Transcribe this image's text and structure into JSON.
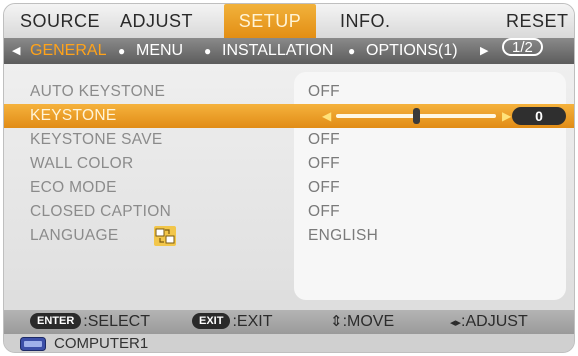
{
  "tabs": [
    {
      "label": "SOURCE",
      "active": false
    },
    {
      "label": "ADJUST",
      "active": false
    },
    {
      "label": "SETUP",
      "active": true
    },
    {
      "label": "INFO.",
      "active": false
    },
    {
      "label": "RESET",
      "active": false
    }
  ],
  "subtabs": {
    "prev_arrow": "◀",
    "items": [
      "GENERAL",
      "MENU",
      "INSTALLATION",
      "OPTIONS(1)"
    ],
    "selected": "GENERAL",
    "next_arrow": "▶",
    "page": "1/2"
  },
  "settings": [
    {
      "label": "AUTO KEYSTONE",
      "value": "OFF"
    },
    {
      "label": "KEYSTONE",
      "value": "0",
      "selected": true,
      "slider_level": 0.5
    },
    {
      "label": "KEYSTONE SAVE",
      "value": "OFF"
    },
    {
      "label": "WALL COLOR",
      "value": "OFF"
    },
    {
      "label": "ECO MODE",
      "value": "OFF"
    },
    {
      "label": "CLOSED CAPTION",
      "value": "OFF"
    },
    {
      "label": "LANGUAGE",
      "value": "ENGLISH",
      "icon": "language-icon"
    }
  ],
  "help": {
    "enter_key": "ENTER",
    "enter_action": ":SELECT",
    "exit_key": "EXIT",
    "exit_action": ":EXIT",
    "move_glyph": "⇕",
    "move_action": ":MOVE",
    "adjust_glyph": "◂▸",
    "adjust_action": ":ADJUST"
  },
  "source": {
    "icon": "computer-input-icon",
    "name": "COMPUTER1"
  },
  "colors": {
    "accent": "#F0A030",
    "subtab_selected": "#FFA31A",
    "value_pill": "#2F2F2F"
  }
}
